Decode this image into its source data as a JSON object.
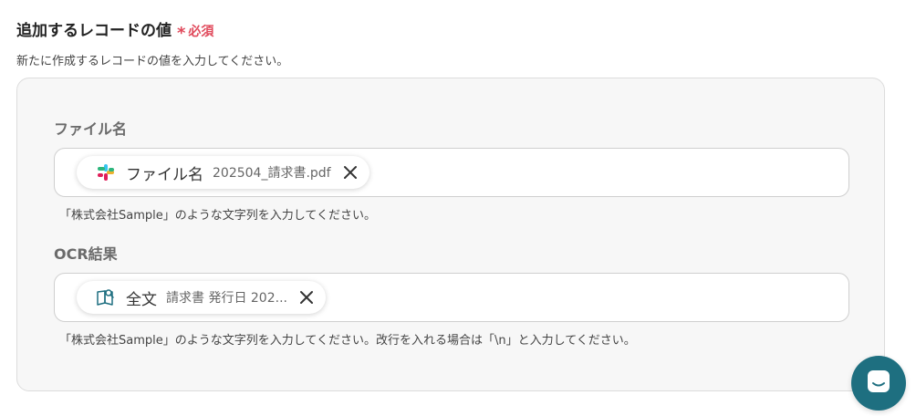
{
  "section": {
    "title": "追加するレコードの値",
    "required_mark": "*",
    "required_label": "必須",
    "description": "新たに作成するレコードの値を入力してください。"
  },
  "fields": [
    {
      "label": "ファイル名",
      "chip": {
        "icon": "slack-icon",
        "title": "ファイル名",
        "value": "202504_請求書.pdf"
      },
      "hint": "「株式会社Sample」のような文字列を入力してください。"
    },
    {
      "label": "OCR結果",
      "chip": {
        "icon": "ocr-book-icon",
        "title": "全文",
        "value": "請求書 発行日 202..."
      },
      "hint": "「株式会社Sample」のような文字列を入力してください。改行を入れる場合は「\\n」と入力してください。"
    }
  ],
  "colors": {
    "required": "#e0495b",
    "panel_bg": "#f7f7f7",
    "fab_bg": "#1e6f80"
  },
  "chat_button": {
    "icon": "chat-icon"
  }
}
